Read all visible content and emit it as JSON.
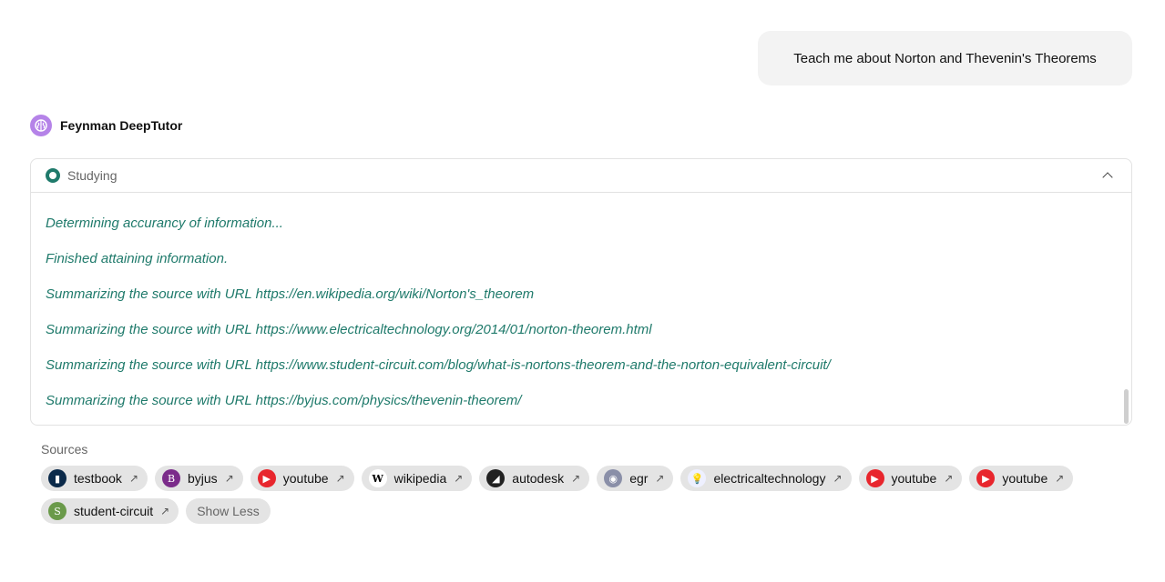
{
  "user_message": "Teach me about Norton and Thevenin's Theorems",
  "assistant": {
    "name": "Feynman DeepTutor",
    "logo_icon": "brain-icon",
    "logo_color": "#b583e8"
  },
  "status": {
    "label": "Studying",
    "color": "#1f7a6b",
    "expanded": true
  },
  "log": [
    "Determining accurancy of information...",
    "Finished attaining information.",
    "Summarizing the source with URL https://en.wikipedia.org/wiki/Norton's_theorem",
    "Summarizing the source with URL https://www.electricaltechnology.org/2014/01/norton-theorem.html",
    "Summarizing the source with URL https://www.student-circuit.com/blog/what-is-nortons-theorem-and-the-norton-equivalent-circuit/",
    "Summarizing the source with URL https://byjus.com/physics/thevenin-theorem/"
  ],
  "sources_label": "Sources",
  "sources": [
    {
      "label": "testbook",
      "icon": "testbook-icon",
      "color": "#0b2a4a",
      "glyph": "▮"
    },
    {
      "label": "byjus",
      "icon": "byjus-icon",
      "color": "#7b2c8a",
      "glyph": "B"
    },
    {
      "label": "youtube",
      "icon": "youtube-icon",
      "color": "#e8262d",
      "glyph": "▶"
    },
    {
      "label": "wikipedia",
      "icon": "wikipedia-icon",
      "color": "#ffffff",
      "glyph": "W"
    },
    {
      "label": "autodesk",
      "icon": "autodesk-icon",
      "color": "#222222",
      "glyph": "◢"
    },
    {
      "label": "egr",
      "icon": "egr-icon",
      "color": "#8a8fa8",
      "glyph": "◉"
    },
    {
      "label": "electricaltechnology",
      "icon": "lightbulb-icon",
      "color": "#eef0ff",
      "glyph": "💡"
    },
    {
      "label": "youtube",
      "icon": "youtube-icon",
      "color": "#e8262d",
      "glyph": "▶"
    },
    {
      "label": "youtube",
      "icon": "youtube-icon",
      "color": "#e8262d",
      "glyph": "▶"
    },
    {
      "label": "student-circuit",
      "icon": "student-circuit-icon",
      "color": "#6a9a4a",
      "glyph": "S"
    }
  ],
  "show_less_label": "Show Less"
}
